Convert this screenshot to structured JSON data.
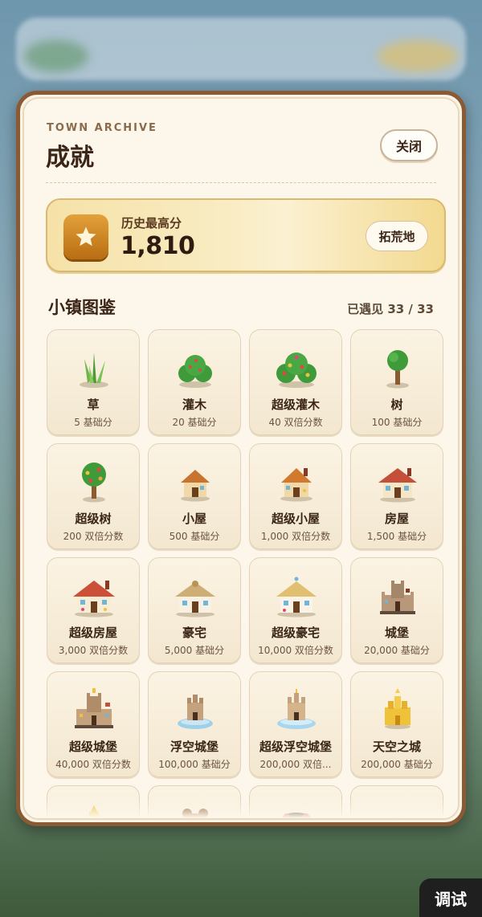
{
  "modal": {
    "eyebrow": "TOWN ARCHIVE",
    "title": "成就",
    "close_label": "关闭"
  },
  "high_score": {
    "label": "历史最高分",
    "value": "1,810",
    "action_label": "拓荒地",
    "icon": "star-icon"
  },
  "collection": {
    "title": "小镇图鉴",
    "count": "已遇见 33 / 33",
    "items": [
      {
        "name": "草",
        "points": "5 基础分",
        "icon": "grass"
      },
      {
        "name": "灌木",
        "points": "20 基础分",
        "icon": "bush"
      },
      {
        "name": "超级灌木",
        "points": "40 双倍分数",
        "icon": "super-bush"
      },
      {
        "name": "树",
        "points": "100 基础分",
        "icon": "tree"
      },
      {
        "name": "超级树",
        "points": "200 双倍分数",
        "icon": "super-tree"
      },
      {
        "name": "小屋",
        "points": "500 基础分",
        "icon": "hut"
      },
      {
        "name": "超级小屋",
        "points": "1,000 双倍分数",
        "icon": "super-hut"
      },
      {
        "name": "房屋",
        "points": "1,500 基础分",
        "icon": "house"
      },
      {
        "name": "超级房屋",
        "points": "3,000 双倍分数",
        "icon": "super-house"
      },
      {
        "name": "豪宅",
        "points": "5,000 基础分",
        "icon": "mansion"
      },
      {
        "name": "超级豪宅",
        "points": "10,000 双倍分数",
        "icon": "super-mansion"
      },
      {
        "name": "城堡",
        "points": "20,000 基础分",
        "icon": "castle"
      },
      {
        "name": "超级城堡",
        "points": "40,000 双倍分数",
        "icon": "super-castle"
      },
      {
        "name": "浮空城堡",
        "points": "100,000 基础分",
        "icon": "floating-castle"
      },
      {
        "name": "超级浮空城堡",
        "points": "200,000 双倍...",
        "icon": "super-floating-castle"
      },
      {
        "name": "天空之城",
        "points": "200,000 基础分",
        "icon": "sky-city"
      }
    ]
  },
  "debug_label": "调试",
  "colors": {
    "frame": "#8a5a34",
    "panel": "#fdf7eb",
    "gold": "#e3a13a",
    "text": "#3b2516"
  }
}
